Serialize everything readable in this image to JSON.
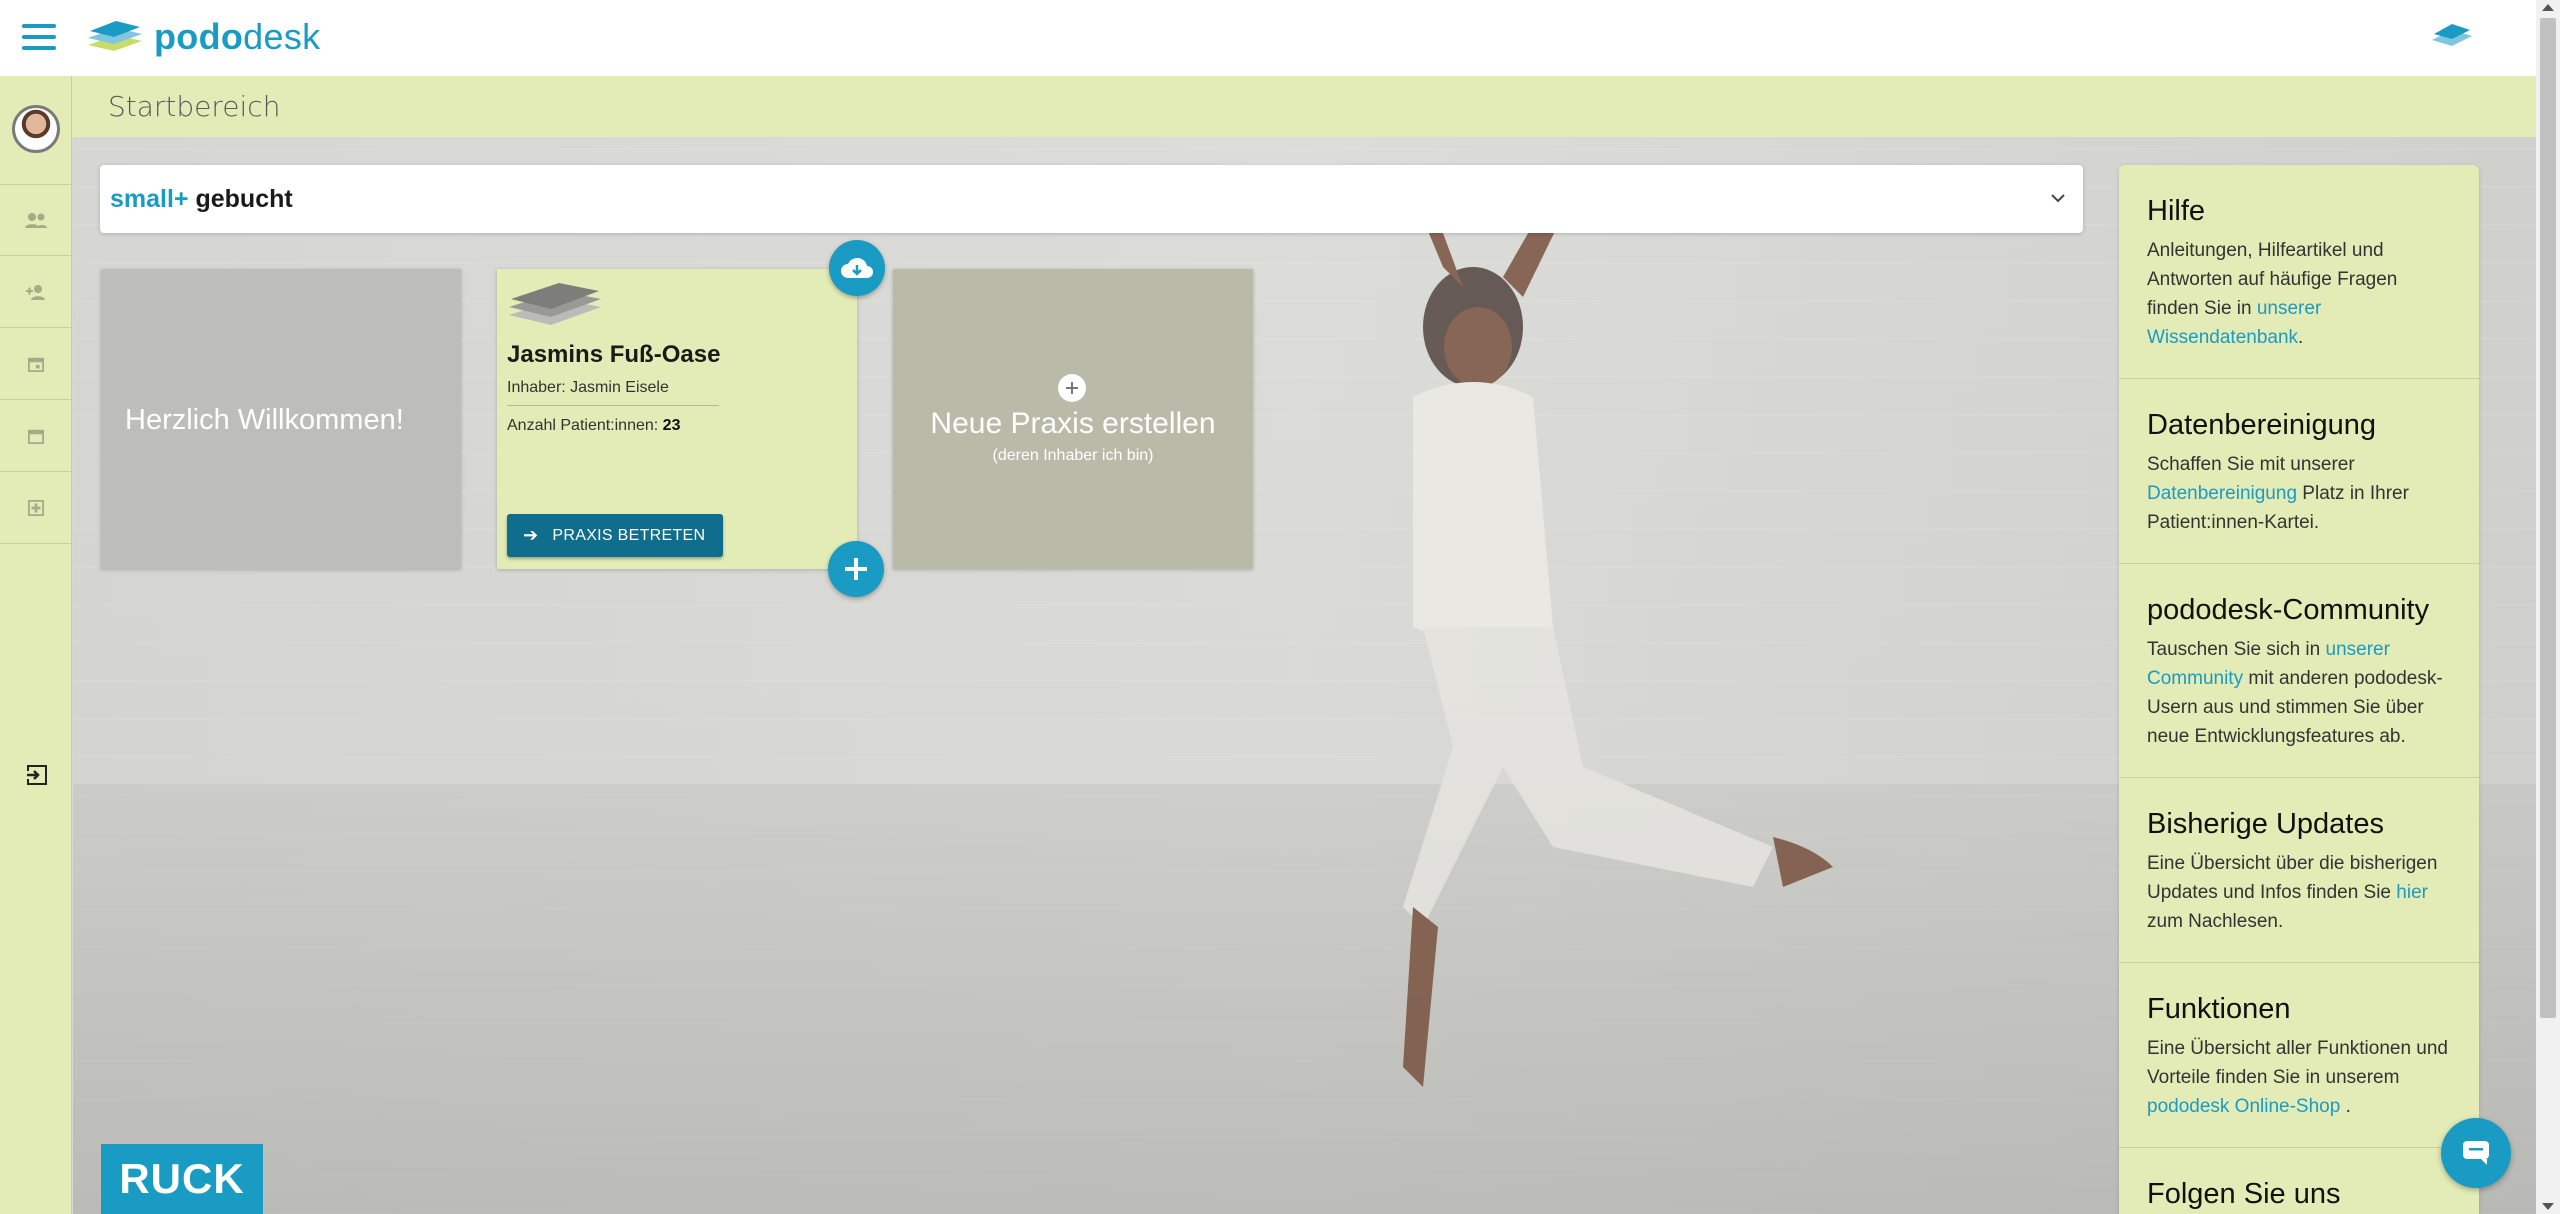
{
  "header": {
    "logo_text_bold": "podo",
    "logo_text_light": "desk"
  },
  "subheader": {
    "title": "Startbereich"
  },
  "package": {
    "plan": "small+",
    "status": "gebucht"
  },
  "cards": {
    "welcome": "Herzlich Willkommen!",
    "practice": {
      "name": "Jasmins Fuß-Oase",
      "owner": "Inhaber: Jasmin Eisele",
      "patients_label": "Anzahl Patient:innen:",
      "patients_count": "23",
      "enter_button": "PRAXIS BETRETEN"
    },
    "new_practice": {
      "title": "Neue Praxis erstellen",
      "subtitle": "(deren Inhaber ich bin)"
    }
  },
  "help": {
    "hilfe": {
      "title": "Hilfe",
      "text": "Anleitungen, Hilfeartikel und Antworten auf häufige Fragen finden Sie in ",
      "link": "unserer Wissendatenbank",
      "after": "."
    },
    "daten": {
      "title": "Datenbereinigung",
      "text": "Schaffen Sie mit unserer ",
      "link": "Datenbereinigung",
      "after": " Platz in Ihrer Patient:innen-Kartei."
    },
    "community": {
      "title": "pododesk-Community",
      "text": "Tauschen Sie sich in ",
      "link": "unserer Community",
      "after": " mit anderen pododesk-Usern aus und stimmen Sie über neue Entwicklungsfeatures ab."
    },
    "updates": {
      "title": "Bisherige Updates",
      "text": "Eine Übersicht über die bisherigen Updates und Infos finden Sie ",
      "link": "hier",
      "after": " zum Nachlesen."
    },
    "funktionen": {
      "title": "Funktionen",
      "text": "Eine Übersicht aller Funktionen und Vorteile finden Sie in unserem ",
      "link": "pododesk Online-Shop",
      "after": " ."
    },
    "folgen": {
      "title": "Folgen Sie uns"
    }
  },
  "footer": {
    "brand": "RUCK"
  },
  "colors": {
    "accent": "#1a9bc4",
    "panel": "#e3ebb6",
    "button": "#0f6e8d"
  },
  "icons": [
    "menu-icon",
    "pododesk-logo-icon",
    "patients-icon",
    "add-patient-icon",
    "calendar-check-icon",
    "calendar-icon",
    "medical-plus-icon",
    "logout-icon",
    "chevron-down-icon",
    "cloud-download-icon",
    "plus-icon",
    "arrow-right-icon",
    "chat-icon"
  ]
}
